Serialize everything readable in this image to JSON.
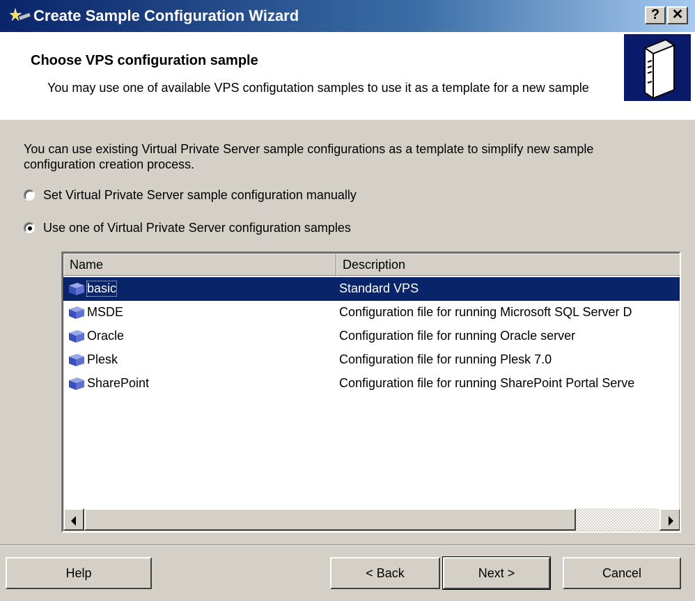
{
  "window": {
    "title": "Create Sample Configuration Wizard",
    "help_glyph": "?",
    "close_glyph": "✕"
  },
  "header": {
    "title": "Choose VPS configuration sample",
    "description": "You may use one of available VPS configutation samples to use it as a template for a new sample",
    "icon": "server-icon"
  },
  "body": {
    "intro": "You can use existing Virtual Private Server sample configurations as a template to simplify new sample configuration creation process.",
    "options": [
      {
        "label": "Set Virtual Private Server sample configuration manually",
        "checked": false
      },
      {
        "label": "Use one of Virtual Private Server configuration samples",
        "checked": true
      }
    ]
  },
  "list": {
    "columns": [
      "Name",
      "Description"
    ],
    "rows": [
      {
        "name": "basic",
        "description": "Standard VPS",
        "selected": true
      },
      {
        "name": "MSDE",
        "description": "Configuration file for running Microsoft SQL Server D",
        "selected": false
      },
      {
        "name": "Oracle",
        "description": "Configuration file for running Oracle server",
        "selected": false
      },
      {
        "name": "Plesk",
        "description": "Configuration file for running Plesk 7.0",
        "selected": false
      },
      {
        "name": "SharePoint",
        "description": "Configuration file for running SharePoint Portal Serve",
        "selected": false
      }
    ]
  },
  "buttons": {
    "help": "Help",
    "back": "< Back",
    "next": "Next >",
    "cancel": "Cancel"
  },
  "colors": {
    "selection": "#0a246a",
    "titlebar_start": "#0a246a",
    "titlebar_end": "#a6caf0",
    "face": "#d4d0c8"
  }
}
